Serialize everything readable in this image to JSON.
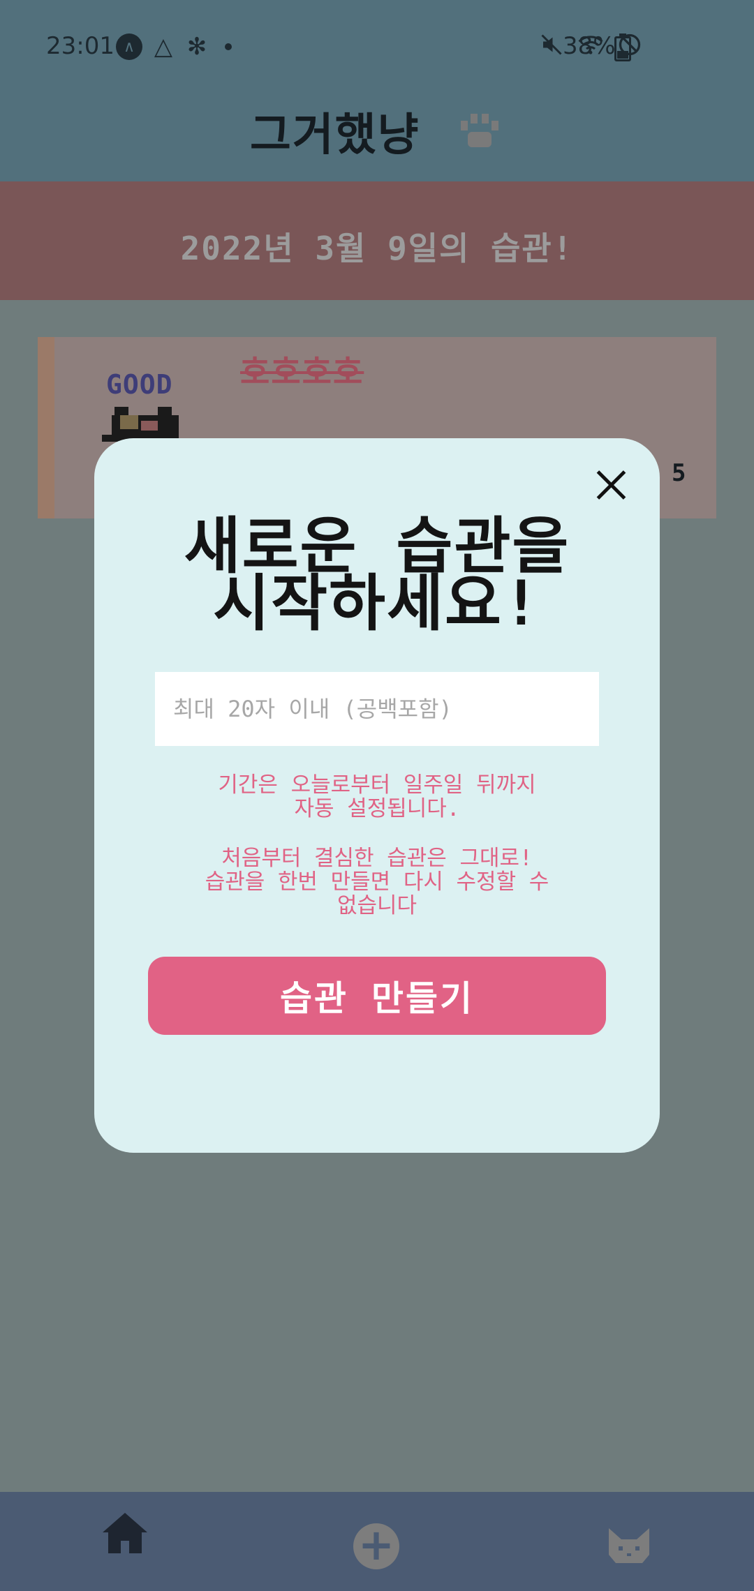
{
  "status_bar": {
    "time": "23:01",
    "icons_left": [
      "a-icon",
      "drive-icon",
      "settings-icon",
      "dot"
    ],
    "icons_right": [
      "mute-icon",
      "wifi-icon",
      "dnd-icon"
    ],
    "battery_text": "38%",
    "battery_level": 0.38
  },
  "app": {
    "title": "그거했냥"
  },
  "date_banner": {
    "text": "2022년 3월 9일의 습관!"
  },
  "habit_card": {
    "title": "호호호호",
    "badge": "GOOD",
    "count": "5"
  },
  "modal": {
    "heading_line1": "새로운 습관을",
    "heading_line2": "시작하세요!",
    "input_placeholder": "최대 20자 이내 (공백포함)",
    "input_value": "",
    "notice1_line1": "기간은 오늘로부터 일주일 뒤까지",
    "notice1_line2": "자동 설정됩니다.",
    "notice2_line1": "처음부터 결심한 습관은 그대로!",
    "notice2_line2": "습관을 한번 만들면 다시 수정할 수",
    "notice2_line3": "없습니다",
    "submit_label": "습관 만들기"
  },
  "bottom_nav": {
    "items": [
      {
        "icon": "home-icon",
        "active": true
      },
      {
        "icon": "add-circle-icon",
        "active": false
      },
      {
        "icon": "cat-icon",
        "active": false
      }
    ]
  },
  "colors": {
    "status_bg": "#52707c",
    "date_banner_bg": "#7a5657",
    "modal_bg": "#dcf1f2",
    "accent_pink": "#e16285",
    "nav_bg": "#4b5b73"
  }
}
